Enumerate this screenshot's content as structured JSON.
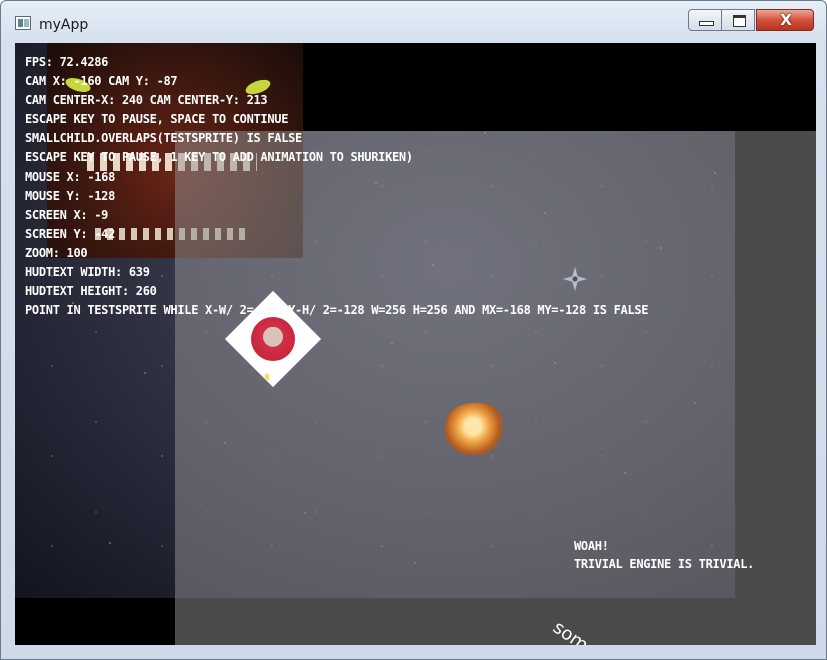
{
  "window": {
    "title": "myApp",
    "controls": {
      "minimize_icon": "minimize-icon",
      "maximize_icon": "maximize-icon",
      "close_label": "X"
    }
  },
  "hud": {
    "lines": [
      "FPS: 72.4286",
      "CAM X: -160  CAM Y: -87",
      "CAM CENTER-X: 240  CAM CENTER-Y: 213",
      "ESCAPE KEY TO PAUSE, SPACE TO CONTINUE",
      "SMALLCHILD.OVERLAPS(TESTSPRITE) IS FALSE",
      "ESCAPE KEY TO PAUSE, 1 KEY TO ADD ANIMATION TO SHURIKEN)",
      "MOUSE X: -168",
      "MOUSE Y: -128",
      "SCREEN X: -9",
      "SCREEN Y: -42",
      "ZOOM: 100",
      "HUDTEXT WIDTH: 639",
      "HUDTEXT HEIGHT: 260",
      "POINT IN TESTSPRITE WHILE X-W/ 2=-128 Y-H/ 2=-128 W=256 H=256 AND MX=-168 MY=-128 IS FALSE"
    ]
  },
  "scene": {
    "woah_line1": "WOAH!",
    "woah_line2": "TRIVIAL ENGINE IS TRIVIAL.",
    "rotated_text": "some mo"
  },
  "colors": {
    "close_button": "#c7412c",
    "viewport_bg": "#000000",
    "hud_text": "#ffffff"
  }
}
